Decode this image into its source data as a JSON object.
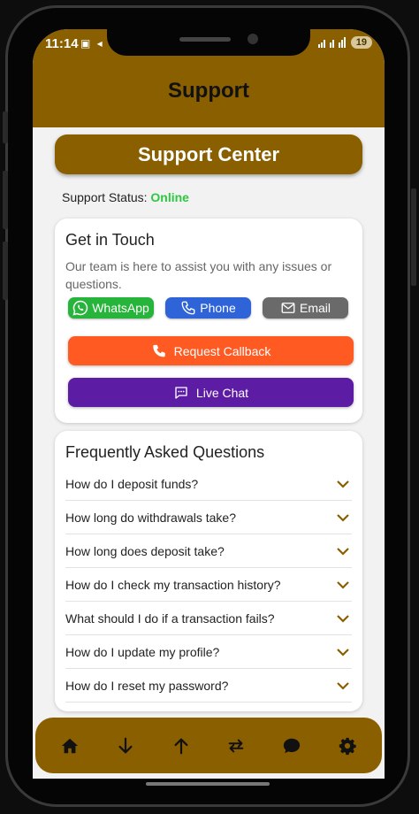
{
  "status_bar": {
    "time": "11:14",
    "icons_left": "▣ ◂",
    "battery": "19"
  },
  "header": {
    "title": "Support"
  },
  "banner": {
    "label": "Support Center"
  },
  "support_status": {
    "label": "Support Status:",
    "value": "Online",
    "value_color": "#2bc93f"
  },
  "contact": {
    "title": "Get in Touch",
    "description": "Our team is here to assist you with any issues or questions.",
    "buttons": [
      {
        "label": "WhatsApp",
        "icon": "whatsapp-icon",
        "color": "#26b43a"
      },
      {
        "label": "Phone",
        "icon": "phone-icon",
        "color": "#2f64d8"
      },
      {
        "label": "Email",
        "icon": "mail-icon",
        "color": "#6a6a6a"
      }
    ],
    "callback_label": "Request Callback",
    "live_chat_label": "Live Chat"
  },
  "faq": {
    "title": "Frequently Asked Questions",
    "items": [
      "How do I deposit funds?",
      "How long do withdrawals take?",
      "How long does deposit take?",
      "How do I check my transaction history?",
      "What should I do if a transaction fails?",
      "How do I update my profile?",
      "How do I reset my password?"
    ]
  },
  "nav": [
    "home-icon",
    "arrow-down-icon",
    "arrow-up-icon",
    "transfer-icon",
    "chat-icon",
    "gear-icon"
  ],
  "colors": {
    "brand": "#8a5f00",
    "callback": "#ff5a22",
    "chat": "#5c1ca3"
  }
}
